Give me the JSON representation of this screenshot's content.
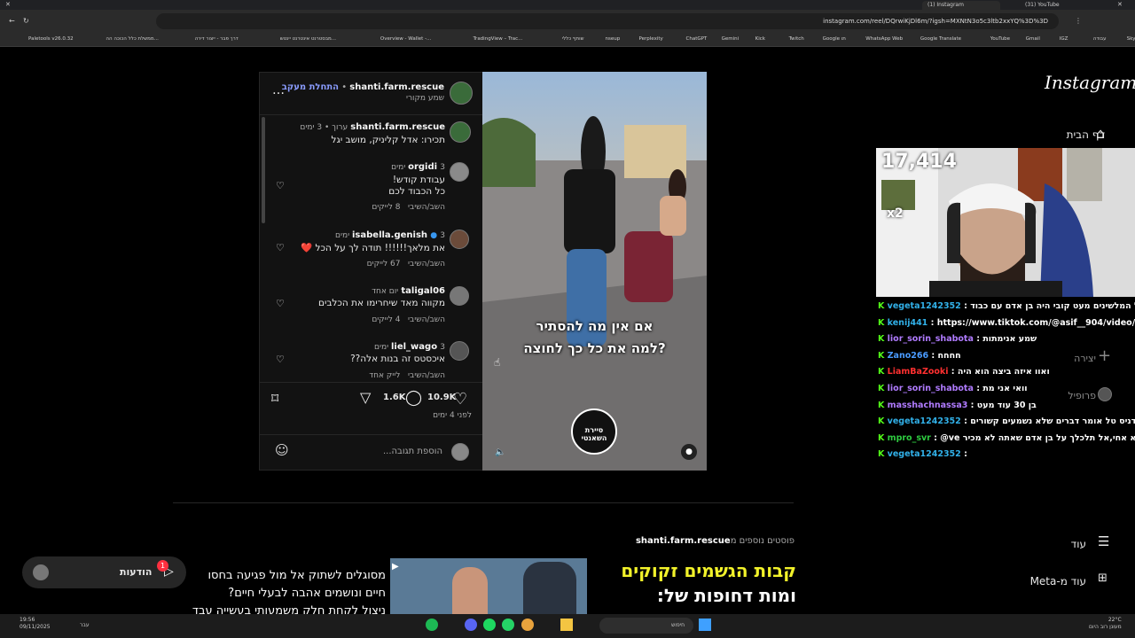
{
  "browser": {
    "tabs": [
      {
        "label": "(1) Instagram",
        "active": true
      },
      {
        "label": "(31) YouTube",
        "active": false
      }
    ],
    "url": "instagram.com/reel/DQrwiKjDl6m/?igsh=MXNtN3o5c3ltb2xxYQ%3D%3D",
    "bookmarks": [
      "Paletools v26.0.32",
      "ממשלת כלל הכוכה הה...",
      "דרך פבר - ייצור דירה",
      "מבסטרנט אינטרנט יינטש...",
      "Overview - Wallet -...",
      "TradingView – Trac...",
      "שותף כללי",
      "nseup",
      "Perplexity",
      "ChatGPT",
      "Gemini",
      "Kick",
      "Twitch",
      "Google תו",
      "WhatsApp Web",
      "Google Translate",
      "YouTube",
      "Gmail",
      "IGZ",
      "עבודה",
      "SkyWay Tours",
      "סדרות וסרטים בעבר...",
      "משכנתא",
      "כללי"
    ]
  },
  "post": {
    "author": "shanti.farm.rescue",
    "follow_label": "התחלת מעקב",
    "subtitle": "שמע מקורי",
    "caption": {
      "user": "shanti.farm.rescue",
      "meta": "ערוך • 3 ימים",
      "text": "תכירו: אדל קליניק, מושב יגל"
    },
    "comments": [
      {
        "user": "orgidi",
        "time": "3 ימים",
        "lines": [
          "עבודת קודש!",
          "כל הכבוד לכם"
        ],
        "likes": "8 לייקים",
        "reply": "השב/השיבי"
      },
      {
        "user": "isabella.genish",
        "time": "3 ימים",
        "lines": [
          "את מלאך!!!!!! תודה לך על הכל ❤️"
        ],
        "likes": "67 לייקים",
        "reply": "השב/השיבי"
      },
      {
        "user": "taligal06",
        "time": "יום אחד",
        "lines": [
          "מקווה מאד שיחרימו את הכלבים"
        ],
        "likes": "4 לייקים",
        "reply": "השב/השיבי"
      },
      {
        "user": "liel_wago",
        "time": "3 ימים",
        "lines": [
          "איכסטס זה בנות אלה??"
        ],
        "likes": "לייק אחד",
        "reply": "השב/השיבי"
      }
    ],
    "likes_count": "10.9K",
    "comments_count": "1.6K",
    "posted": "לפני 4 ימים",
    "add_comment_placeholder": "הוספת תגובה...",
    "video_caption_lines": [
      "אם אין מה להסתיר",
      "למה את כל כך לחוצה?"
    ],
    "video_logo": "סיירת השאנטי"
  },
  "more_posts": {
    "heading": "פוסטים נוספים מ",
    "author": "shanti.farm.rescue",
    "thumb1_lines": [
      "מסוגלים לשתוק אל מול פגיעה בחסו",
      "חיים ונושמים אהבה לבעלי חיים?",
      "ניצול לקחת חלק משמעותי בעשייה עבד"
    ],
    "thumb2_lines": [
      "קבות הגשמים זקוקים",
      "ומות דחופות של:"
    ]
  },
  "notifications": {
    "label": "הודעות",
    "count": "1"
  },
  "instagram_nav": {
    "logo": "Instagram",
    "items": [
      {
        "label": "דף הבית",
        "icon": "home-icon"
      },
      {
        "label": "יצירה",
        "icon": "plus-icon"
      },
      {
        "label": "פרופיל",
        "icon": "profile-icon"
      }
    ],
    "more": "עוד",
    "meta": "עוד מ-Meta"
  },
  "stream": {
    "viewer_count": "17,414",
    "multiplier": "x2",
    "chat": [
      {
        "user": "vegeta1242352",
        "color": "#31b0e8",
        "msg": "מא של המלשינים מעט קובי היה בן אדם עם כבוד"
      },
      {
        "user": "kenij441",
        "color": "#31b0e8",
        "msg": "https://www.tiktok.com/@asif__904/video/756"
      },
      {
        "user": "lior_sorin_shabota",
        "color": "#b07bff",
        "msg": "שמע אנימתות"
      },
      {
        "user": "Zano266",
        "color": "#4a9bff",
        "msg": "חחחח"
      },
      {
        "user": "LiamBaZooki",
        "color": "#ff3030",
        "msg": "ואוו איזה ביצה הוא היה"
      },
      {
        "user": "lior_sorin_shabota",
        "color": "#b07bff",
        "msg": "וואי אני מת"
      },
      {
        "user": "masshachnassa3",
        "color": "#b07bff",
        "msg": "בן 30 עוד מעט"
      },
      {
        "user": "vegeta1242352",
        "color": "#31b0e8",
        "msg": "ום כמו דניס טל אומר דברים שלא נשמעים קשורים"
      },
      {
        "user": "mpro_svr",
        "color": "#2ecc40",
        "msg": "@ve הוא לא אחי,אל תלכלך על בן אדם שאתה לא מכיר"
      },
      {
        "user": "vegeta1242352",
        "color": "#31b0e8",
        "msg": ""
      }
    ]
  },
  "taskbar": {
    "time": "19:56",
    "date": "09/11/2025",
    "search": "חיפוש",
    "weather": "22°C",
    "weather_desc": "מעונן רוב היום",
    "lang": "עבר"
  }
}
